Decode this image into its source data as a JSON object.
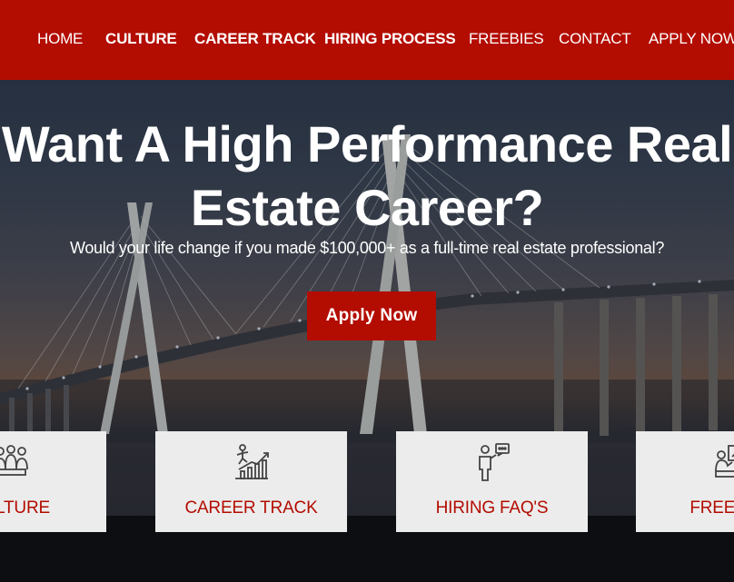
{
  "nav": {
    "items": [
      {
        "label": "HOME",
        "bold": false
      },
      {
        "label": "CULTURE",
        "bold": true
      },
      {
        "label": "CAREER TRACK",
        "bold": true
      },
      {
        "label": "HIRING PROCESS",
        "bold": true
      },
      {
        "label": "FREEBIES",
        "bold": false
      },
      {
        "label": "CONTACT",
        "bold": false
      },
      {
        "label": "APPLY NOW",
        "bold": false
      }
    ]
  },
  "hero": {
    "headline_line1": "Want A High Performance Real",
    "headline_line2": "Estate Career?",
    "subheadline": "Would your life change if you made $100,000+ as a full-time real estate professional?",
    "cta_label": "Apply Now"
  },
  "cards": [
    {
      "label": "CULTURE",
      "icon": "team-icon"
    },
    {
      "label": "CAREER TRACK",
      "icon": "growth-chart-icon"
    },
    {
      "label": "HIRING FAQ'S",
      "icon": "speaker-faq-icon"
    },
    {
      "label": "FREEBIES",
      "icon": "presentation-icon"
    }
  ],
  "colors": {
    "brand_red": "#b30c00",
    "card_bg": "#ececec",
    "text_white": "#ffffff"
  }
}
